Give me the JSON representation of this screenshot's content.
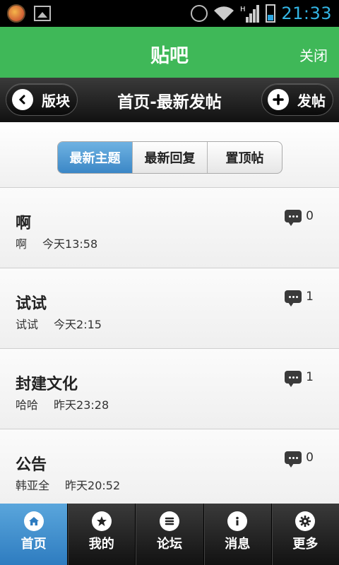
{
  "status_bar": {
    "time": "21:33",
    "icons": [
      "app-notification-icon",
      "image-icon",
      "alarm-icon",
      "wifi-icon",
      "signal-icon",
      "battery-icon"
    ],
    "clock_color": "#33b5e5"
  },
  "header": {
    "title": "贴吧",
    "close_label": "关闭",
    "background": "#3fb858"
  },
  "nav": {
    "back_label": "版块",
    "title": "首页-最新发帖",
    "post_label": "发帖"
  },
  "filter_tabs": [
    {
      "label": "最新主题",
      "active": true
    },
    {
      "label": "最新回复",
      "active": false
    },
    {
      "label": "置顶帖",
      "active": false
    }
  ],
  "posts": [
    {
      "title": "啊",
      "author": "啊",
      "time": "今天13:58",
      "comments": "0"
    },
    {
      "title": "试试",
      "author": "试试",
      "time": "今天2:15",
      "comments": "1"
    },
    {
      "title": "封建文化",
      "author": "哈哈",
      "time": "昨天23:28",
      "comments": "1"
    },
    {
      "title": "公告",
      "author": "韩亚全",
      "time": "昨天20:52",
      "comments": "0"
    }
  ],
  "bottom_tabs": [
    {
      "label": "首页",
      "icon": "home-icon",
      "active": true
    },
    {
      "label": "我的",
      "icon": "star-icon",
      "active": false
    },
    {
      "label": "论坛",
      "icon": "menu-icon",
      "active": false
    },
    {
      "label": "消息",
      "icon": "info-icon",
      "active": false
    },
    {
      "label": "更多",
      "icon": "gear-icon",
      "active": false
    }
  ],
  "colors": {
    "accent_blue": "#3b87c6",
    "nav_dark": "#111111"
  }
}
